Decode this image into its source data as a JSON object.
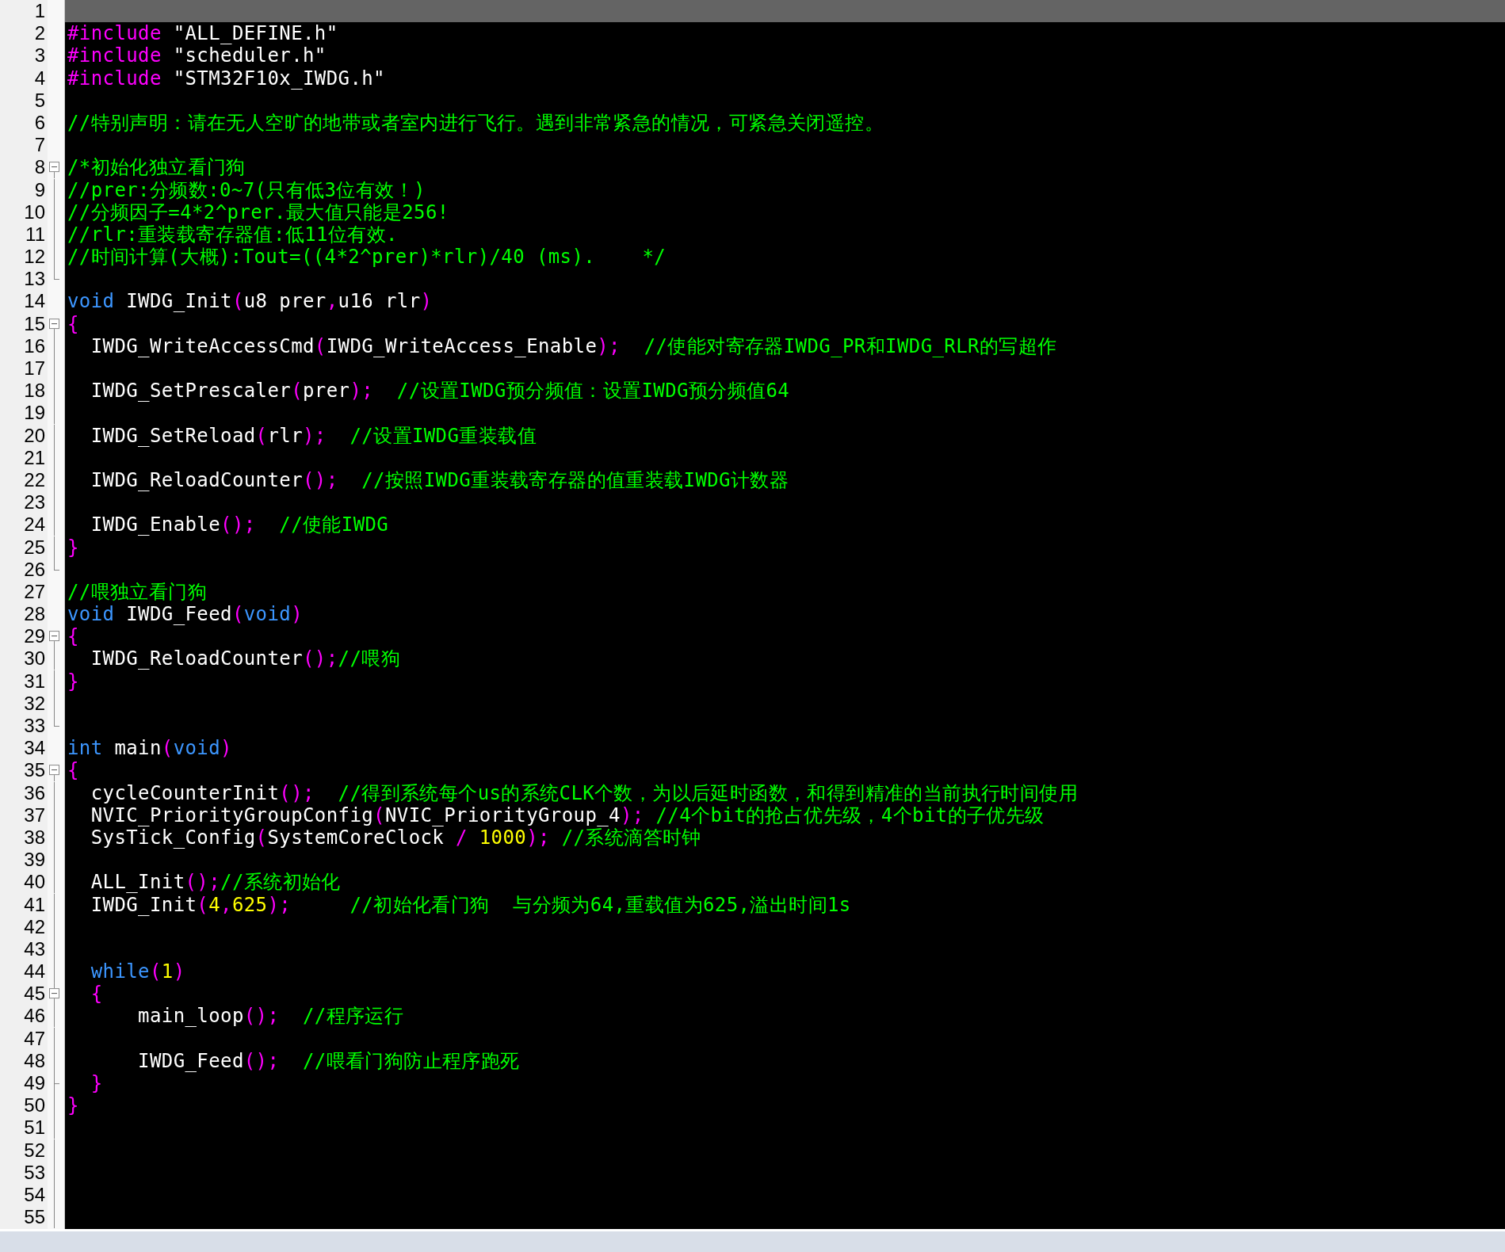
{
  "editor": {
    "lines": [
      {
        "n": "1",
        "current": true,
        "fold_box": false,
        "guide": false,
        "guide_end": false
      },
      {
        "n": "2",
        "current": false,
        "fold_box": false,
        "guide": false,
        "guide_end": false,
        "tokens": [
          {
            "kind": "pp",
            "t": "#include"
          },
          {
            "kind": "txt",
            "t": " \"ALL_DEFINE.h\""
          }
        ]
      },
      {
        "n": "3",
        "current": false,
        "fold_box": false,
        "guide": false,
        "guide_end": false,
        "tokens": [
          {
            "kind": "pp",
            "t": "#include"
          },
          {
            "kind": "txt",
            "t": " \"scheduler.h\""
          }
        ]
      },
      {
        "n": "4",
        "current": false,
        "fold_box": false,
        "guide": false,
        "guide_end": false,
        "tokens": [
          {
            "kind": "pp",
            "t": "#include"
          },
          {
            "kind": "txt",
            "t": " \"STM32F10x_IWDG.h\""
          }
        ]
      },
      {
        "n": "5",
        "current": false,
        "fold_box": false,
        "guide": false,
        "guide_end": false
      },
      {
        "n": "6",
        "current": false,
        "fold_box": false,
        "guide": false,
        "guide_end": false,
        "tokens": [
          {
            "kind": "cmt",
            "t": "//特别声明：请在无人空旷的地带或者室内进行飞行。遇到非常紧急的情况，可紧急关闭遥控。"
          }
        ]
      },
      {
        "n": "7",
        "current": false,
        "fold_box": false,
        "guide": false,
        "guide_end": false
      },
      {
        "n": "8",
        "current": false,
        "fold_box": true,
        "guide": false,
        "guide_end": false,
        "tokens": [
          {
            "kind": "cmt",
            "t": "/*初始化独立看门狗"
          }
        ]
      },
      {
        "n": "9",
        "current": false,
        "fold_box": false,
        "guide": true,
        "guide_end": false,
        "tokens": [
          {
            "kind": "cmt",
            "t": "//prer:分频数:0~7(只有低3位有效！)"
          }
        ]
      },
      {
        "n": "10",
        "current": false,
        "fold_box": false,
        "guide": true,
        "guide_end": false,
        "tokens": [
          {
            "kind": "cmt",
            "t": "//分频因子=4*2^prer.最大值只能是256!"
          }
        ]
      },
      {
        "n": "11",
        "current": false,
        "fold_box": false,
        "guide": true,
        "guide_end": false,
        "tokens": [
          {
            "kind": "cmt",
            "t": "//rlr:重装载寄存器值:低11位有效."
          }
        ]
      },
      {
        "n": "12",
        "current": false,
        "fold_box": false,
        "guide": true,
        "guide_end": false,
        "tokens": [
          {
            "kind": "cmt",
            "t": "//时间计算(大概):Tout=((4*2^prer)*rlr)/40 (ms).    */"
          }
        ]
      },
      {
        "n": "13",
        "current": false,
        "fold_box": false,
        "guide": false,
        "guide_end": true
      },
      {
        "n": "14",
        "current": false,
        "fold_box": false,
        "guide": false,
        "guide_end": false,
        "tokens": [
          {
            "kind": "kw",
            "t": "void"
          },
          {
            "kind": "txt",
            "t": " IWDG_Init"
          },
          {
            "kind": "pun",
            "t": "("
          },
          {
            "kind": "txt",
            "t": "u8 prer"
          },
          {
            "kind": "pun",
            "t": ","
          },
          {
            "kind": "txt",
            "t": "u16 rlr"
          },
          {
            "kind": "pun",
            "t": ")"
          }
        ]
      },
      {
        "n": "15",
        "current": false,
        "fold_box": true,
        "guide": false,
        "guide_end": false,
        "tokens": [
          {
            "kind": "pun",
            "t": "{"
          }
        ]
      },
      {
        "n": "16",
        "current": false,
        "fold_box": false,
        "guide": true,
        "guide_end": false,
        "tokens": [
          {
            "kind": "txt",
            "t": "  IWDG_WriteAccessCmd"
          },
          {
            "kind": "pun",
            "t": "("
          },
          {
            "kind": "txt",
            "t": "IWDG_WriteAccess_Enable"
          },
          {
            "kind": "pun",
            "t": ");  "
          },
          {
            "kind": "cmt",
            "t": "//使能对寄存器IWDG_PR和IWDG_RLR的写超作"
          }
        ]
      },
      {
        "n": "17",
        "current": false,
        "fold_box": false,
        "guide": true,
        "guide_end": false
      },
      {
        "n": "18",
        "current": false,
        "fold_box": false,
        "guide": true,
        "guide_end": false,
        "tokens": [
          {
            "kind": "txt",
            "t": "  IWDG_SetPrescaler"
          },
          {
            "kind": "pun",
            "t": "("
          },
          {
            "kind": "txt",
            "t": "prer"
          },
          {
            "kind": "pun",
            "t": ");  "
          },
          {
            "kind": "cmt",
            "t": "//设置IWDG预分频值：设置IWDG预分频值64"
          }
        ]
      },
      {
        "n": "19",
        "current": false,
        "fold_box": false,
        "guide": true,
        "guide_end": false
      },
      {
        "n": "20",
        "current": false,
        "fold_box": false,
        "guide": true,
        "guide_end": false,
        "tokens": [
          {
            "kind": "txt",
            "t": "  IWDG_SetReload"
          },
          {
            "kind": "pun",
            "t": "("
          },
          {
            "kind": "txt",
            "t": "rlr"
          },
          {
            "kind": "pun",
            "t": ");  "
          },
          {
            "kind": "cmt",
            "t": "//设置IWDG重装载值"
          }
        ]
      },
      {
        "n": "21",
        "current": false,
        "fold_box": false,
        "guide": true,
        "guide_end": false
      },
      {
        "n": "22",
        "current": false,
        "fold_box": false,
        "guide": true,
        "guide_end": false,
        "tokens": [
          {
            "kind": "txt",
            "t": "  IWDG_ReloadCounter"
          },
          {
            "kind": "pun",
            "t": "();  "
          },
          {
            "kind": "cmt",
            "t": "//按照IWDG重装载寄存器的值重装载IWDG计数器"
          }
        ]
      },
      {
        "n": "23",
        "current": false,
        "fold_box": false,
        "guide": true,
        "guide_end": false
      },
      {
        "n": "24",
        "current": false,
        "fold_box": false,
        "guide": true,
        "guide_end": false,
        "tokens": [
          {
            "kind": "txt",
            "t": "  IWDG_Enable"
          },
          {
            "kind": "pun",
            "t": "();  "
          },
          {
            "kind": "cmt",
            "t": "//使能IWDG"
          }
        ]
      },
      {
        "n": "25",
        "current": false,
        "fold_box": false,
        "guide": true,
        "guide_end": false,
        "tokens": [
          {
            "kind": "pun",
            "t": "}"
          }
        ]
      },
      {
        "n": "26",
        "current": false,
        "fold_box": false,
        "guide": false,
        "guide_end": true
      },
      {
        "n": "27",
        "current": false,
        "fold_box": false,
        "guide": false,
        "guide_end": false,
        "tokens": [
          {
            "kind": "cmt",
            "t": "//喂独立看门狗"
          }
        ]
      },
      {
        "n": "28",
        "current": false,
        "fold_box": false,
        "guide": false,
        "guide_end": false,
        "tokens": [
          {
            "kind": "kw",
            "t": "void"
          },
          {
            "kind": "txt",
            "t": " IWDG_Feed"
          },
          {
            "kind": "pun",
            "t": "("
          },
          {
            "kind": "kw",
            "t": "void"
          },
          {
            "kind": "pun",
            "t": ")"
          }
        ]
      },
      {
        "n": "29",
        "current": false,
        "fold_box": true,
        "guide": false,
        "guide_end": false,
        "tokens": [
          {
            "kind": "pun",
            "t": "{"
          }
        ]
      },
      {
        "n": "30",
        "current": false,
        "fold_box": false,
        "guide": true,
        "guide_end": false,
        "tokens": [
          {
            "kind": "txt",
            "t": "  IWDG_ReloadCounter"
          },
          {
            "kind": "pun",
            "t": "();"
          },
          {
            "kind": "cmt",
            "t": "//喂狗"
          }
        ]
      },
      {
        "n": "31",
        "current": false,
        "fold_box": false,
        "guide": true,
        "guide_end": false,
        "tokens": [
          {
            "kind": "pun",
            "t": "}"
          }
        ]
      },
      {
        "n": "32",
        "current": false,
        "fold_box": false,
        "guide": true,
        "guide_end": false
      },
      {
        "n": "33",
        "current": false,
        "fold_box": false,
        "guide": false,
        "guide_end": true
      },
      {
        "n": "34",
        "current": false,
        "fold_box": false,
        "guide": false,
        "guide_end": false,
        "tokens": [
          {
            "kind": "kw",
            "t": "int"
          },
          {
            "kind": "txt",
            "t": " main"
          },
          {
            "kind": "pun",
            "t": "("
          },
          {
            "kind": "kw",
            "t": "void"
          },
          {
            "kind": "pun",
            "t": ")"
          }
        ]
      },
      {
        "n": "35",
        "current": false,
        "fold_box": true,
        "guide": false,
        "guide_end": false,
        "tokens": [
          {
            "kind": "pun",
            "t": "{"
          }
        ]
      },
      {
        "n": "36",
        "current": false,
        "fold_box": false,
        "guide": true,
        "guide_end": false,
        "tokens": [
          {
            "kind": "txt",
            "t": "  cycleCounterInit"
          },
          {
            "kind": "pun",
            "t": "();  "
          },
          {
            "kind": "cmt",
            "t": "//得到系统每个us的系统CLK个数，为以后延时函数，和得到精准的当前执行时间使用"
          }
        ]
      },
      {
        "n": "37",
        "current": false,
        "fold_box": false,
        "guide": true,
        "guide_end": false,
        "tokens": [
          {
            "kind": "txt",
            "t": "  NVIC_PriorityGroupConfig"
          },
          {
            "kind": "pun",
            "t": "("
          },
          {
            "kind": "txt",
            "t": "NVIC_PriorityGroup_4"
          },
          {
            "kind": "pun",
            "t": "); "
          },
          {
            "kind": "cmt",
            "t": "//4个bit的抢占优先级，4个bit的子优先级"
          }
        ]
      },
      {
        "n": "38",
        "current": false,
        "fold_box": false,
        "guide": true,
        "guide_end": false,
        "tokens": [
          {
            "kind": "txt",
            "t": "  SysTick_Config"
          },
          {
            "kind": "pun",
            "t": "("
          },
          {
            "kind": "txt",
            "t": "SystemCoreClock "
          },
          {
            "kind": "pun",
            "t": "/ "
          },
          {
            "kind": "num",
            "t": "1000"
          },
          {
            "kind": "pun",
            "t": "); "
          },
          {
            "kind": "cmt",
            "t": "//系统滴答时钟"
          }
        ]
      },
      {
        "n": "39",
        "current": false,
        "fold_box": false,
        "guide": true,
        "guide_end": false
      },
      {
        "n": "40",
        "current": false,
        "fold_box": false,
        "guide": true,
        "guide_end": false,
        "tokens": [
          {
            "kind": "txt",
            "t": "  ALL_Init"
          },
          {
            "kind": "pun",
            "t": "();"
          },
          {
            "kind": "cmt",
            "t": "//系统初始化"
          }
        ]
      },
      {
        "n": "41",
        "current": false,
        "fold_box": false,
        "guide": true,
        "guide_end": false,
        "tokens": [
          {
            "kind": "txt",
            "t": "  IWDG_Init"
          },
          {
            "kind": "pun",
            "t": "("
          },
          {
            "kind": "num",
            "t": "4"
          },
          {
            "kind": "pun",
            "t": ","
          },
          {
            "kind": "num",
            "t": "625"
          },
          {
            "kind": "pun",
            "t": ");     "
          },
          {
            "kind": "cmt",
            "t": "//初始化看门狗  与分频为64,重载值为625,溢出时间1s"
          }
        ]
      },
      {
        "n": "42",
        "current": false,
        "fold_box": false,
        "guide": true,
        "guide_end": false
      },
      {
        "n": "43",
        "current": false,
        "fold_box": false,
        "guide": true,
        "guide_end": false
      },
      {
        "n": "44",
        "current": false,
        "fold_box": false,
        "guide": true,
        "guide_end": false,
        "tokens": [
          {
            "kind": "kw",
            "t": "  while"
          },
          {
            "kind": "pun",
            "t": "("
          },
          {
            "kind": "num",
            "t": "1"
          },
          {
            "kind": "pun",
            "t": ")"
          }
        ]
      },
      {
        "n": "45",
        "current": false,
        "fold_box": true,
        "guide": true,
        "guide_end": false,
        "tokens": [
          {
            "kind": "pun",
            "t": "  {"
          }
        ]
      },
      {
        "n": "46",
        "current": false,
        "fold_box": false,
        "guide": true,
        "guide_end": false,
        "tokens": [
          {
            "kind": "txt",
            "t": "      main_loop"
          },
          {
            "kind": "pun",
            "t": "();  "
          },
          {
            "kind": "cmt",
            "t": "//程序运行"
          }
        ]
      },
      {
        "n": "47",
        "current": false,
        "fold_box": false,
        "guide": true,
        "guide_end": false
      },
      {
        "n": "48",
        "current": false,
        "fold_box": false,
        "guide": true,
        "guide_end": false,
        "tokens": [
          {
            "kind": "txt",
            "t": "      IWDG_Feed"
          },
          {
            "kind": "pun",
            "t": "();  "
          },
          {
            "kind": "cmt",
            "t": "//喂看门狗防止程序跑死"
          }
        ]
      },
      {
        "n": "49",
        "current": false,
        "fold_box": false,
        "guide": true,
        "guide_end": true,
        "tokens": [
          {
            "kind": "pun",
            "t": "  }"
          }
        ]
      },
      {
        "n": "50",
        "current": false,
        "fold_box": false,
        "guide": true,
        "guide_end": false,
        "tokens": [
          {
            "kind": "pun",
            "t": "}"
          }
        ]
      },
      {
        "n": "51",
        "current": false,
        "fold_box": false,
        "guide": true,
        "guide_end": false
      },
      {
        "n": "52",
        "current": false,
        "fold_box": false,
        "guide": true,
        "guide_end": false
      },
      {
        "n": "53",
        "current": false,
        "fold_box": false,
        "guide": true,
        "guide_end": false
      },
      {
        "n": "54",
        "current": false,
        "fold_box": false,
        "guide": true,
        "guide_end": false
      },
      {
        "n": "55",
        "current": false,
        "fold_box": false,
        "guide": true,
        "guide_end": false
      }
    ]
  }
}
